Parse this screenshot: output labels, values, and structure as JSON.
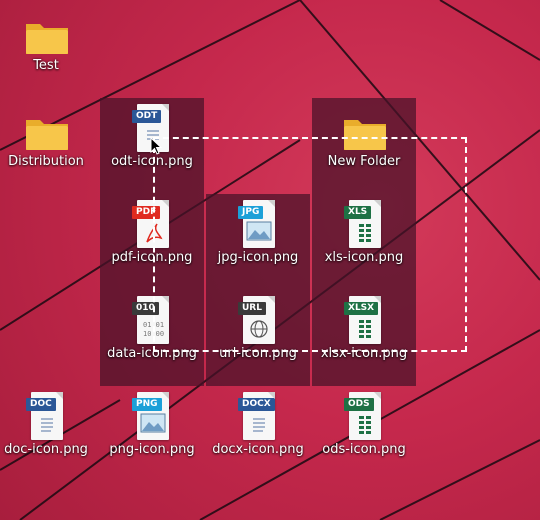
{
  "desktop": {
    "items": [
      {
        "id": "test",
        "label": "Test",
        "kind": "folder",
        "selected": false
      },
      {
        "id": "distribution",
        "label": "Distribution",
        "kind": "folder",
        "selected": false
      },
      {
        "id": "odt",
        "label": "odt-icon.png",
        "kind": "file",
        "badge": "ODT",
        "badge_color": "#2b5797",
        "selected": true
      },
      {
        "id": "newfolder",
        "label": "New Folder",
        "kind": "folder",
        "selected": true
      },
      {
        "id": "pdf",
        "label": "pdf-icon.png",
        "kind": "file",
        "badge": "PDF",
        "badge_color": "#e02a20",
        "selected": true
      },
      {
        "id": "jpg",
        "label": "jpg-icon.png",
        "kind": "file",
        "badge": "JPG",
        "badge_color": "#1ba0d8",
        "selected": true
      },
      {
        "id": "xls",
        "label": "xls-icon.png",
        "kind": "file",
        "badge": "XLS",
        "badge_color": "#1e7145",
        "selected": true
      },
      {
        "id": "data",
        "label": "data-icon.png",
        "kind": "file",
        "badge": "010",
        "badge_color": "#3a3a3a",
        "selected": true
      },
      {
        "id": "url",
        "label": "url-icon.png",
        "kind": "file",
        "badge": "URL",
        "badge_color": "#3a3a3a",
        "selected": true
      },
      {
        "id": "xlsx",
        "label": "xlsx-icon.png",
        "kind": "file",
        "badge": "XLSX",
        "badge_color": "#1e7145",
        "selected": true
      },
      {
        "id": "doc",
        "label": "doc-icon.png",
        "kind": "file",
        "badge": "DOC",
        "badge_color": "#2b5797",
        "selected": false
      },
      {
        "id": "png",
        "label": "png-icon.png",
        "kind": "file",
        "badge": "PNG",
        "badge_color": "#1ba0d8",
        "selected": false
      },
      {
        "id": "docx",
        "label": "docx-icon.png",
        "kind": "file",
        "badge": "DOCX",
        "badge_color": "#2b5797",
        "selected": false
      },
      {
        "id": "ods",
        "label": "ods-icon.png",
        "kind": "file",
        "badge": "ODS",
        "badge_color": "#1e7145",
        "selected": false
      }
    ]
  },
  "colors": {
    "wallpaper": "#c5284c",
    "selection_tint": "#46122a",
    "folder": "#f7c64a",
    "marquee": "#ffffff"
  }
}
